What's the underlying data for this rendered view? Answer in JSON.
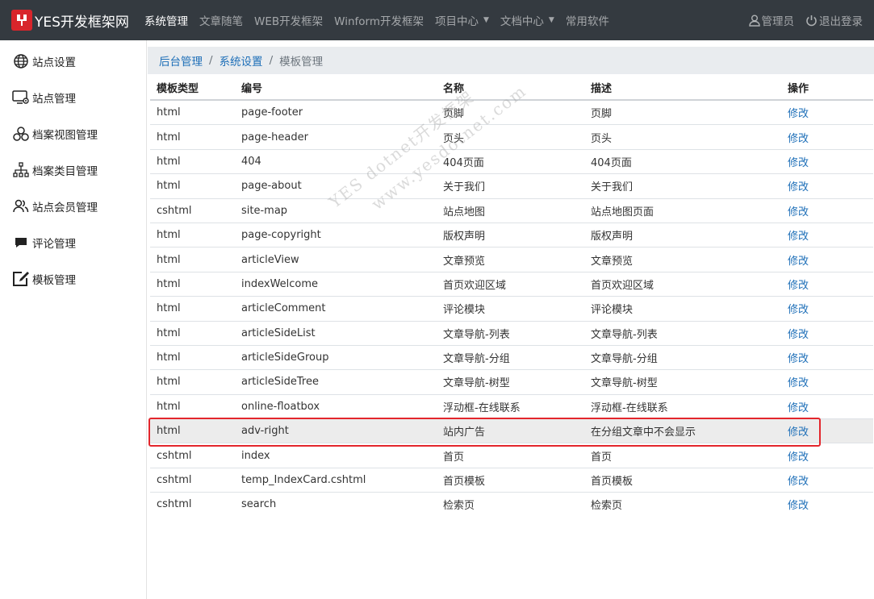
{
  "header": {
    "brand": "YES开发框架网",
    "nav": [
      {
        "label": "系统管理",
        "active": true,
        "dropdown": false
      },
      {
        "label": "文章随笔",
        "active": false,
        "dropdown": false
      },
      {
        "label": "WEB开发框架",
        "active": false,
        "dropdown": false
      },
      {
        "label": "Winform开发框架",
        "active": false,
        "dropdown": false
      },
      {
        "label": "项目中心",
        "active": false,
        "dropdown": true
      },
      {
        "label": "文档中心",
        "active": false,
        "dropdown": true
      },
      {
        "label": "常用软件",
        "active": false,
        "dropdown": false
      }
    ],
    "user": "管理员",
    "logout": "退出登录"
  },
  "sidebar": {
    "items": [
      {
        "label": "站点设置",
        "icon": "globe-icon"
      },
      {
        "label": "站点管理",
        "icon": "monitor-gear-icon"
      },
      {
        "label": "档案视图管理",
        "icon": "circles-icon"
      },
      {
        "label": "档案类目管理",
        "icon": "hierarchy-icon"
      },
      {
        "label": "站点会员管理",
        "icon": "users-icon"
      },
      {
        "label": "评论管理",
        "icon": "comment-icon"
      },
      {
        "label": "模板管理",
        "icon": "edit-icon"
      }
    ]
  },
  "breadcrumb": {
    "items": [
      "后台管理",
      "系统设置"
    ],
    "current": "模板管理"
  },
  "table": {
    "headers": [
      "模板类型",
      "编号",
      "名称",
      "描述",
      "操作"
    ],
    "rows": [
      {
        "type": "html",
        "code": "page-footer",
        "name": "页脚",
        "desc": "页脚",
        "action": "修改"
      },
      {
        "type": "html",
        "code": "page-header",
        "name": "页头",
        "desc": "页头",
        "action": "修改"
      },
      {
        "type": "html",
        "code": "404",
        "name": "404页面",
        "desc": "404页面",
        "action": "修改"
      },
      {
        "type": "html",
        "code": "page-about",
        "name": "关于我们",
        "desc": "关于我们",
        "action": "修改"
      },
      {
        "type": "cshtml",
        "code": "site-map",
        "name": "站点地图",
        "desc": "站点地图页面",
        "action": "修改"
      },
      {
        "type": "html",
        "code": "page-copyright",
        "name": "版权声明",
        "desc": "版权声明",
        "action": "修改"
      },
      {
        "type": "html",
        "code": "articleView",
        "name": "文章预览",
        "desc": "文章预览",
        "action": "修改"
      },
      {
        "type": "html",
        "code": "indexWelcome",
        "name": "首页欢迎区域",
        "desc": "首页欢迎区域",
        "action": "修改"
      },
      {
        "type": "html",
        "code": "articleComment",
        "name": "评论模块",
        "desc": "评论模块",
        "action": "修改"
      },
      {
        "type": "html",
        "code": "articleSideList",
        "name": "文章导航-列表",
        "desc": "文章导航-列表",
        "action": "修改"
      },
      {
        "type": "html",
        "code": "articleSideGroup",
        "name": "文章导航-分组",
        "desc": "文章导航-分组",
        "action": "修改"
      },
      {
        "type": "html",
        "code": "articleSideTree",
        "name": "文章导航-树型",
        "desc": "文章导航-树型",
        "action": "修改"
      },
      {
        "type": "html",
        "code": "online-floatbox",
        "name": "浮动框-在线联系",
        "desc": "浮动框-在线联系",
        "action": "修改"
      },
      {
        "type": "html",
        "code": "adv-right",
        "name": "站内广告",
        "desc": "在分组文章中不会显示",
        "action": "修改",
        "highlighted": true
      },
      {
        "type": "cshtml",
        "code": "index",
        "name": "首页",
        "desc": "首页",
        "action": "修改"
      },
      {
        "type": "cshtml",
        "code": "temp_IndexCard.cshtml",
        "name": "首页模板",
        "desc": "首页模板",
        "action": "修改"
      },
      {
        "type": "cshtml",
        "code": "search",
        "name": "检索页",
        "desc": "检索页",
        "action": "修改"
      }
    ]
  },
  "watermark": {
    "line1": "YES dotnet开发框架",
    "line2": "www.yesdotnet.com"
  },
  "colors": {
    "topbar": "#343a40",
    "link": "#1e6fb8",
    "highlight_border": "#e3262c",
    "logo": "#d8252b"
  }
}
